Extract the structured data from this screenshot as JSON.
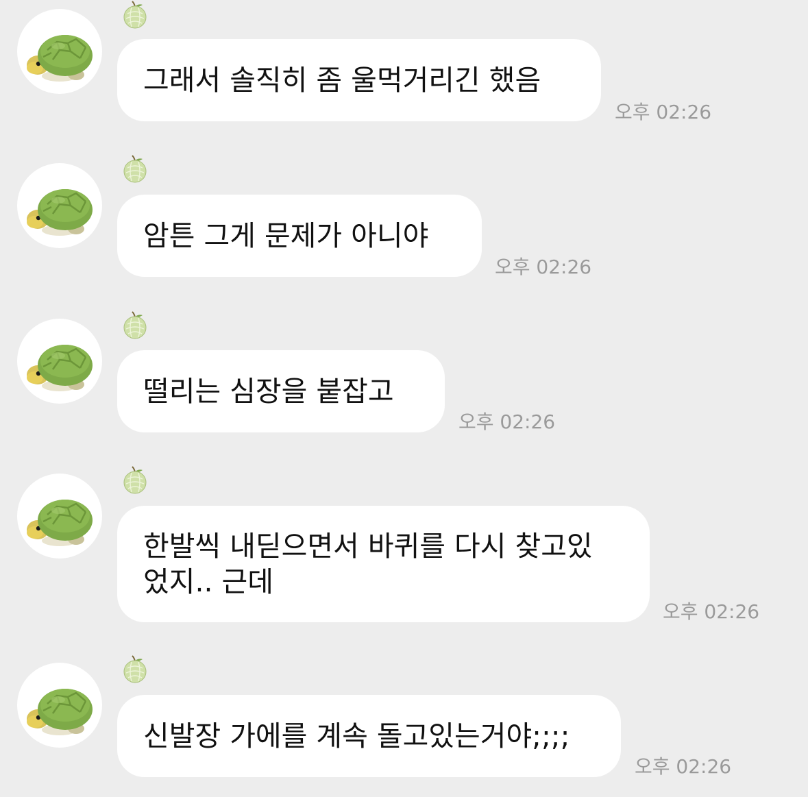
{
  "messages": [
    {
      "text": "그래서 솔직히 좀 울먹거리긴 했음",
      "time": "오후 02:26"
    },
    {
      "text": "암튼 그게 문제가 아니야",
      "time": "오후 02:26"
    },
    {
      "text": "떨리는 심장을 붙잡고",
      "time": "오후 02:26"
    },
    {
      "text": "한발씩 내딛으면서 바퀴를 다시 찾고있\n었지.. 근데",
      "time": "오후 02:26"
    },
    {
      "text": "신발장 가에를 계속 돌고있는거야;;;;",
      "time": "오후 02:26"
    }
  ],
  "icons": {
    "avatar": "turtle-avatar-icon",
    "sender_badge": "melon-icon"
  },
  "colors": {
    "background": "#ededed",
    "bubble": "#ffffff",
    "text": "#111111",
    "timestamp": "#9a9a9a"
  }
}
